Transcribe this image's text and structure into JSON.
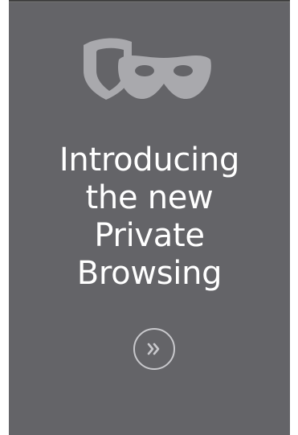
{
  "promo": {
    "headline_lines": [
      "Introducing",
      "the new",
      "Private",
      "Browsing"
    ],
    "icon": "shield-and-mask-icon",
    "next_button_icon": "double-chevron-right-icon"
  },
  "colors": {
    "panel_background": "#646468",
    "icon_gray": "#a9a9ad",
    "text": "#ffffff",
    "button_outline": "#c8c8cc"
  }
}
